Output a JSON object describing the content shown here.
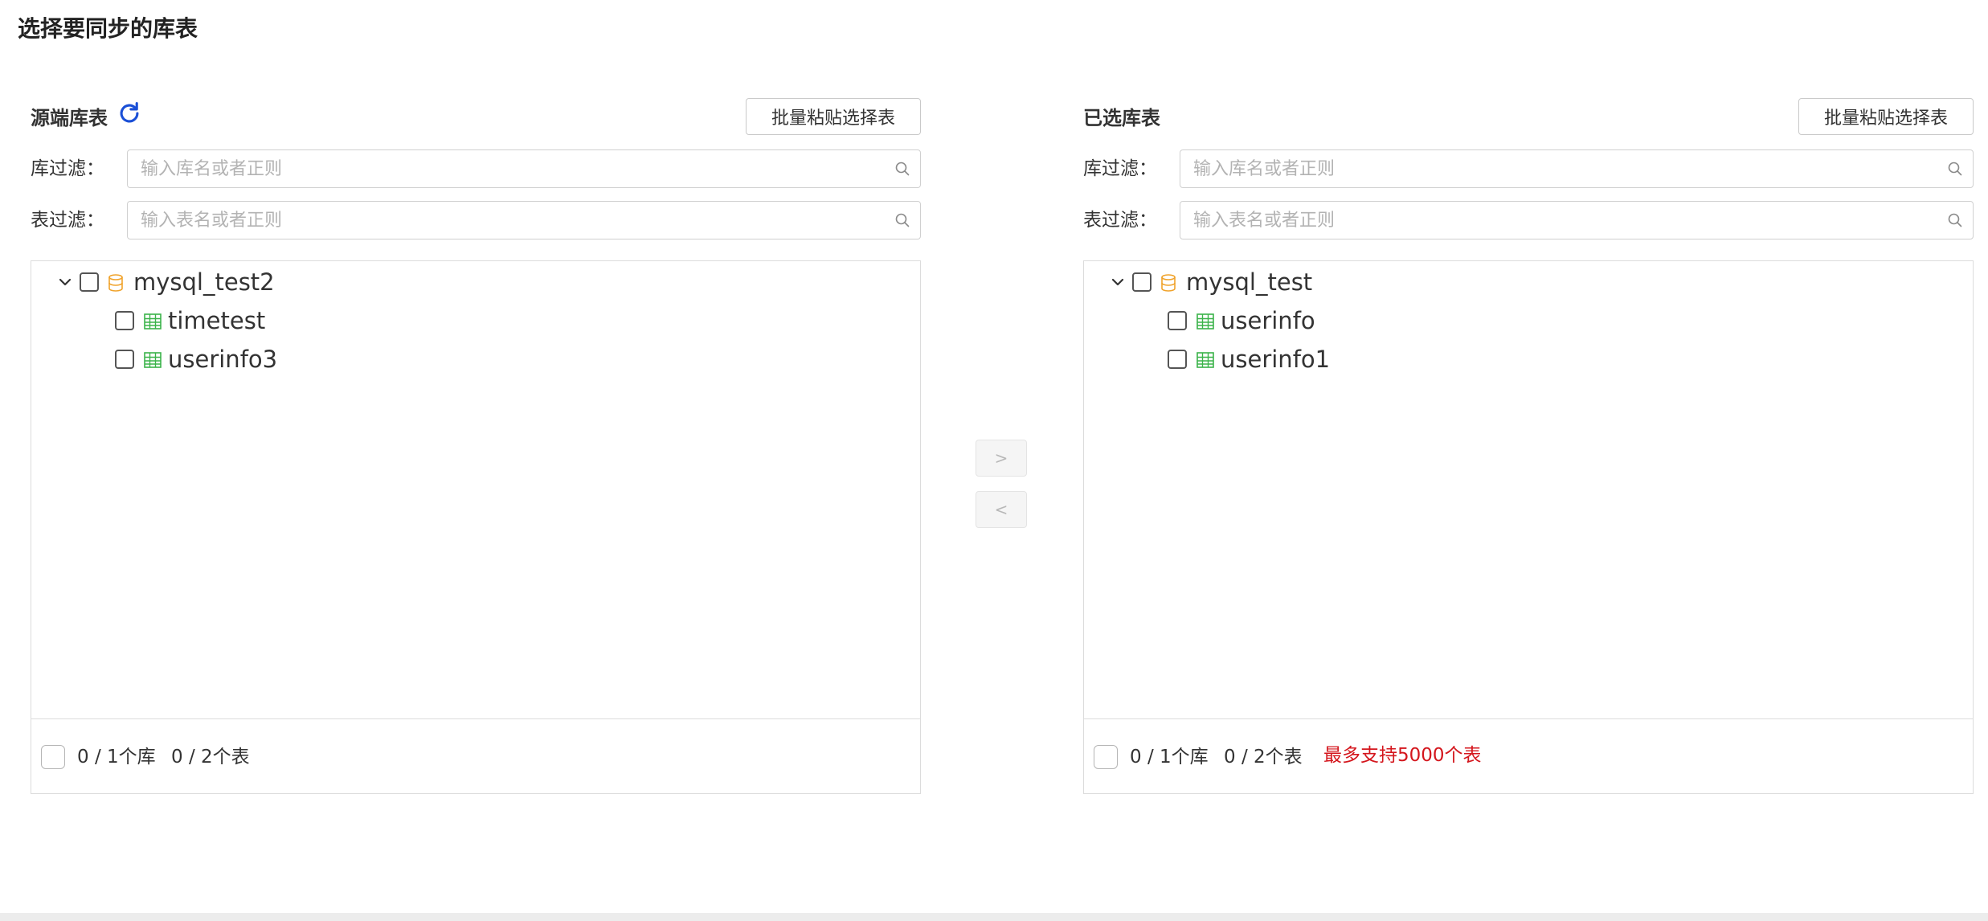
{
  "page": {
    "title": "选择要同步的库表"
  },
  "source": {
    "title": "源端库表",
    "paste_button": "批量粘贴选择表",
    "db_filter": {
      "label": "库过滤：",
      "placeholder": "输入库名或者正则",
      "value": ""
    },
    "table_filter": {
      "label": "表过滤：",
      "placeholder": "输入表名或者正则",
      "value": ""
    },
    "tree": {
      "database": {
        "name": "mysql_test2",
        "expanded": true,
        "checked": false
      },
      "tables": [
        {
          "name": "timetest",
          "checked": false
        },
        {
          "name": "userinfo3",
          "checked": false
        }
      ]
    },
    "footer": {
      "db_count": "0 / 1个库",
      "table_count": "0 / 2个表"
    }
  },
  "selected": {
    "title": "已选库表",
    "paste_button": "批量粘贴选择表",
    "db_filter": {
      "label": "库过滤：",
      "placeholder": "输入库名或者正则",
      "value": ""
    },
    "table_filter": {
      "label": "表过滤：",
      "placeholder": "输入表名或者正则",
      "value": ""
    },
    "tree": {
      "database": {
        "name": "mysql_test",
        "expanded": true,
        "checked": false
      },
      "tables": [
        {
          "name": "userinfo",
          "checked": false
        },
        {
          "name": "userinfo1",
          "checked": false
        }
      ]
    },
    "footer": {
      "db_count": "0 / 1个库",
      "table_count": "0 / 2个表",
      "limit_note": "最多支持5000个表"
    }
  },
  "transfer": {
    "move_right_label": ">",
    "move_left_label": "<",
    "enabled": false
  },
  "icons": {
    "refresh": "refresh-icon",
    "search": "search-icon",
    "expand": "chevron-down-icon",
    "database": "database-icon",
    "table": "table-icon"
  },
  "colors": {
    "refresh_icon": "#1a4fd6",
    "database_icon": "#f0a32c",
    "table_icon": "#3bb34a",
    "warning_text": "#d4161d",
    "border": "#dcdcdc",
    "disabled_button_bg": "#f5f5f5"
  }
}
